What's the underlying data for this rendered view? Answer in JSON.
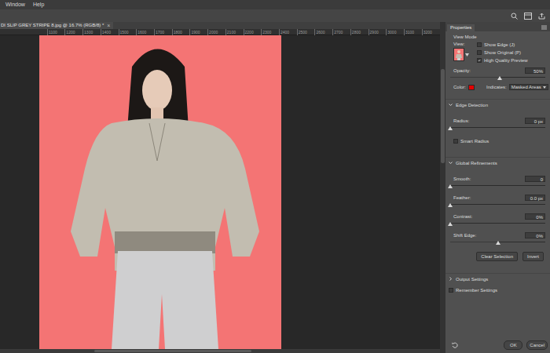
{
  "menu": [
    {
      "label": "Window"
    },
    {
      "label": "Help"
    }
  ],
  "document_tab": {
    "title": "DI SLIP GREY STRIPE 8.jpg @ 16.7% (RGB/8) *",
    "close": "×"
  },
  "ruler": {
    "labels": [
      "1100",
      "1200",
      "1300",
      "1400",
      "1500",
      "1600",
      "1700",
      "1800",
      "1900",
      "2000",
      "2100",
      "2200",
      "2300",
      "2400",
      "2500",
      "2600",
      "2700",
      "2800",
      "2900",
      "3000",
      "3100",
      "3200"
    ]
  },
  "properties": {
    "tab": "Properties",
    "view_mode": {
      "heading": "View Mode",
      "view_label": "View:",
      "options": [
        {
          "label": "Show Edge (J)",
          "checked": false
        },
        {
          "label": "Show Original (P)",
          "checked": false
        },
        {
          "label": "High Quality Preview",
          "checked": true
        }
      ]
    },
    "opacity": {
      "label": "Opacity:",
      "value": "50%",
      "level": 0.52
    },
    "color_label": "Color:",
    "indicates": {
      "label": "Indicates:",
      "value": "Masked Areas"
    },
    "sections": [
      {
        "title": "Edge Detection",
        "expanded": true,
        "rows": [
          {
            "kind": "slider",
            "label": "Radius:",
            "value": "0 px",
            "level": 0
          },
          {
            "kind": "checkbox",
            "label": "Smart Radius",
            "checked": false
          }
        ]
      },
      {
        "title": "Global Refinements",
        "expanded": true,
        "rows": [
          {
            "kind": "slider",
            "label": "Smooth:",
            "value": "0",
            "level": 0
          },
          {
            "kind": "slider",
            "label": "Feather:",
            "value": "0.0 px",
            "level": 0
          },
          {
            "kind": "slider",
            "label": "Contrast:",
            "value": "0%",
            "level": 0
          },
          {
            "kind": "slider",
            "label": "Shift Edge:",
            "value": "0%",
            "level": 0.5
          },
          {
            "kind": "buttons",
            "buttons": [
              "Clear Selection",
              "Invert"
            ]
          }
        ]
      },
      {
        "title": "Output Settings",
        "expanded": false,
        "rows": []
      }
    ],
    "remember": {
      "label": "Remember Settings",
      "checked": false
    },
    "buttons": [
      "OK",
      "Cancel"
    ]
  }
}
